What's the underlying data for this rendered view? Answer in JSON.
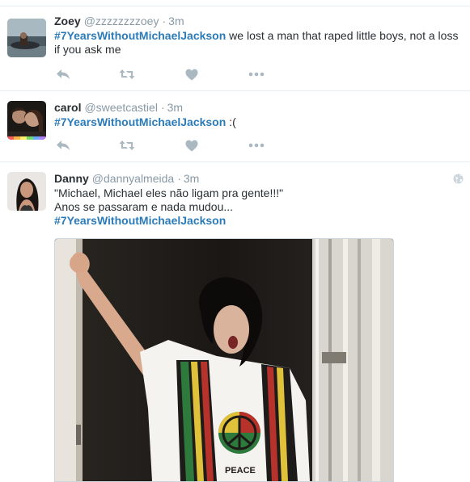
{
  "tweets": [
    {
      "fullname": "Zoey",
      "username": "@zzzzzzzzoey",
      "separator": "·",
      "time": "3m",
      "hashtag": "#7YearsWithoutMichaelJackson",
      "text_after": " we lost a man that raped little boys, not a loss if you ask me"
    },
    {
      "fullname": "carol",
      "username": "@sweetcastiel",
      "separator": "·",
      "time": "3m",
      "hashtag": "#7YearsWithoutMichaelJackson",
      "text_after": " :("
    },
    {
      "fullname": "Danny",
      "username": "@dannyalmeida",
      "separator": "·",
      "time": "3m",
      "line1": "\"Michael, Michael eles não ligam pra gente!!!\"",
      "line2": "Anos se passaram e nada mudou...",
      "hashtag": "#7YearsWithoutMichaelJackson",
      "media_caption": "PEACE"
    }
  ],
  "colors": {
    "hashtag": "#2b7bb9",
    "muted": "#8899a6",
    "icon": "#aab8c2",
    "text": "#292f33",
    "divider": "#e6ecf0"
  },
  "icons": {
    "reply": "reply-arrow-icon",
    "retweet": "retweet-icon",
    "like": "heart-icon",
    "more": "more-dots-icon",
    "globe": "globe-icon"
  }
}
